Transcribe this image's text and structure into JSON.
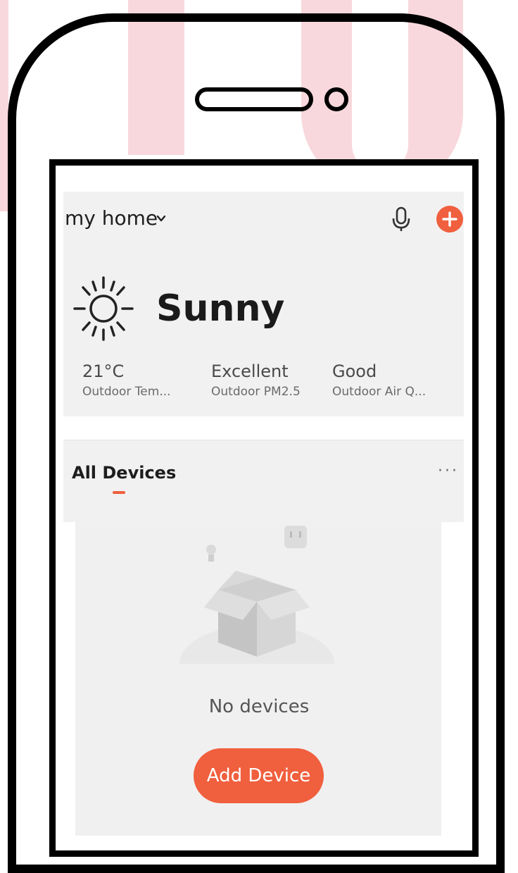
{
  "header": {
    "home_name": "my home"
  },
  "weather": {
    "condition": "Sunny",
    "metrics": [
      {
        "value": "21°C",
        "label": "Outdoor Tem..."
      },
      {
        "value": "Excellent",
        "label": "Outdoor PM2.5"
      },
      {
        "value": "Good",
        "label": "Outdoor Air Q..."
      }
    ]
  },
  "devices": {
    "section_title": "All Devices",
    "more_label": "···",
    "empty_text": "No devices",
    "add_button": "Add Device"
  },
  "icons": {
    "dropdown": "chevron-down-icon",
    "voice": "microphone-icon",
    "add": "plus-circle-icon",
    "weather": "sun-icon"
  },
  "colors": {
    "accent": "#f05f3e",
    "card": "#f1f1f1",
    "background_shape": "#f8d8dc"
  }
}
